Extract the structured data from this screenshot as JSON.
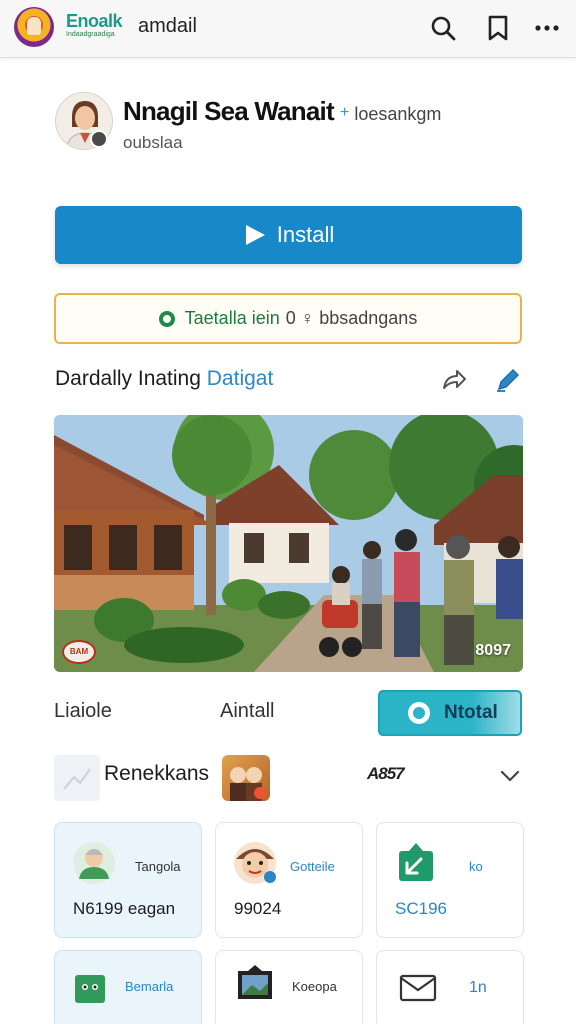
{
  "topbar": {
    "brand_main": "Enoalk",
    "brand_sub": "Indaadgraadiga",
    "app_title": "amdail",
    "icons": [
      "search-icon",
      "bookmark-icon",
      "more-icon"
    ]
  },
  "app": {
    "title": "Nnagil Sea Wanait",
    "separator": "+",
    "developer": "loesankgm",
    "subtitle": "oubslaa"
  },
  "install_button": {
    "label": "Install"
  },
  "notice": {
    "green_text": "Taetalla iein",
    "gray_text": "0 ♀ bbsadngans"
  },
  "section": {
    "title_plain": "Dardally  Inating",
    "title_accent": "Datigat"
  },
  "photo": {
    "badge": "BAM",
    "tag": "8097"
  },
  "row": {
    "label_1": "Liaiole",
    "label_2": "Aintall",
    "toggle_label": "Ntotal"
  },
  "recommendations": {
    "title": "Renekkans",
    "stamp": "A857"
  },
  "cards": [
    {
      "label": "Tangola",
      "value": "N6199 eagan",
      "label_color": "#333333"
    },
    {
      "label": "Gotteile",
      "value": "99024",
      "label_color": "#2a86c5"
    },
    {
      "label": "ko",
      "value": "SC196",
      "label_color": "#2a86c5"
    }
  ],
  "cards_row2": [
    {
      "label": "Bemarla"
    },
    {
      "label": "Koeopa"
    },
    {
      "label": "1n"
    }
  ],
  "colors": {
    "accent": "#1789c9",
    "notice_border": "#e6b54a",
    "toggle": "#2bb4c7"
  }
}
